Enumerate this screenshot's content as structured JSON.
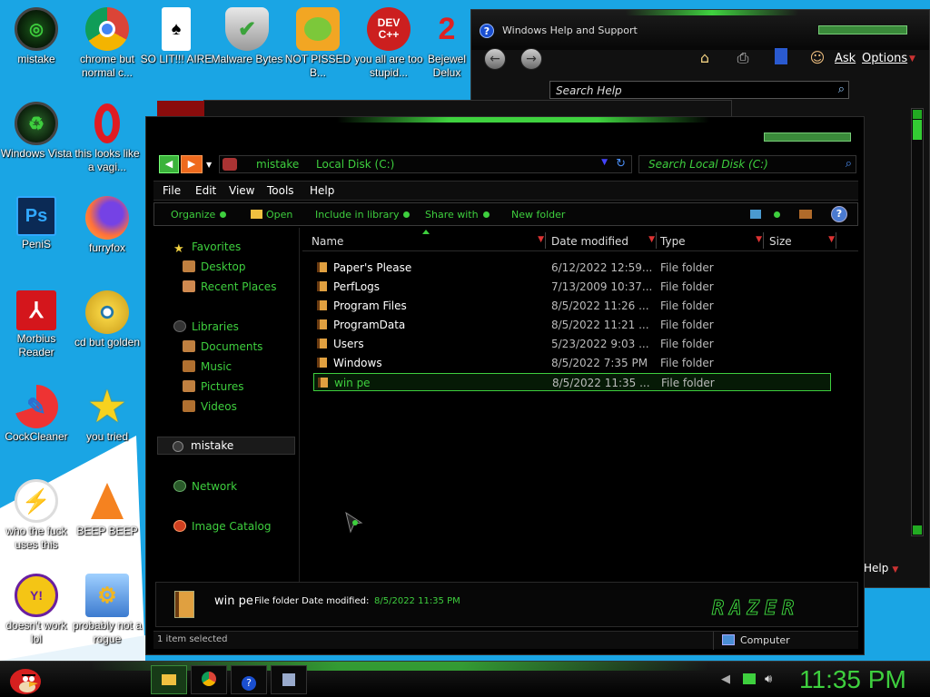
{
  "desktop": {
    "icons": [
      {
        "label": "mistake"
      },
      {
        "label": "chrome but normal c..."
      },
      {
        "label": "SO LIT!!! AIRE"
      },
      {
        "label": "Malware Bytes"
      },
      {
        "label": "NOT PISSED B..."
      },
      {
        "label": "you all are too stupid...",
        "badge": "DEV C++"
      },
      {
        "label": "Bejewel Delux"
      },
      {
        "label": "Windows Vista"
      },
      {
        "label": "this looks like a vagi..."
      },
      {
        "label": "PeniS",
        "badge": "Ps"
      },
      {
        "label": "furryfox"
      },
      {
        "label": "Morbius Reader"
      },
      {
        "label": "cd but golden"
      },
      {
        "label": "CockCleaner"
      },
      {
        "label": "you tried"
      },
      {
        "label": "who the fuck uses this"
      },
      {
        "label": "BEEP BEEP"
      },
      {
        "label": "doesn't work lol",
        "badge": "Y!"
      },
      {
        "label": "probably not a rogue"
      }
    ]
  },
  "help_window": {
    "title": "Windows Help and Support",
    "ask": "Ask",
    "options": "Options",
    "search_placeholder": "Search Help",
    "bottom_tab": "Help"
  },
  "explorer": {
    "breadcrumb": [
      "mistake",
      "Local Disk (C:)"
    ],
    "search_placeholder": "Search Local Disk (C:)",
    "menu": [
      "File",
      "Edit",
      "View",
      "Tools",
      "Help"
    ],
    "toolbar": {
      "organize": "Organize",
      "open": "Open",
      "include": "Include in library",
      "share": "Share with",
      "new_folder": "New folder"
    },
    "nav": {
      "favorites": "Favorites",
      "desktop": "Desktop",
      "recent": "Recent Places",
      "libraries": "Libraries",
      "documents": "Documents",
      "music": "Music",
      "pictures": "Pictures",
      "videos": "Videos",
      "computer": "mistake",
      "network": "Network",
      "image_catalog": "Image Catalog"
    },
    "columns": [
      "Name",
      "Date modified",
      "Type",
      "Size"
    ],
    "files": [
      {
        "name": "Paper's Please",
        "date": "6/12/2022 12:59...",
        "type": "File folder"
      },
      {
        "name": "PerfLogs",
        "date": "7/13/2009 10:37...",
        "type": "File folder"
      },
      {
        "name": "Program Files",
        "date": "8/5/2022 11:26 ...",
        "type": "File folder"
      },
      {
        "name": "ProgramData",
        "date": "8/5/2022 11:21 ...",
        "type": "File folder"
      },
      {
        "name": "Users",
        "date": "5/23/2022 9:03 ...",
        "type": "File folder"
      },
      {
        "name": "Windows",
        "date": "8/5/2022 7:35 PM",
        "type": "File folder"
      },
      {
        "name": "win pe",
        "date": "8/5/2022 11:35 ...",
        "type": "File folder"
      }
    ],
    "details": {
      "name": "win pe",
      "meta": "File folder  Date modified:",
      "date_value": "8/5/2022 11:35 PM"
    },
    "status": {
      "selected": "1 item selected",
      "computer": "Computer"
    },
    "brand": "RAZER"
  },
  "taskbar": {
    "clock": "11:35 PM"
  },
  "colors": {
    "accent": "#3ecf3e",
    "desktop": "#1aa5e4"
  }
}
